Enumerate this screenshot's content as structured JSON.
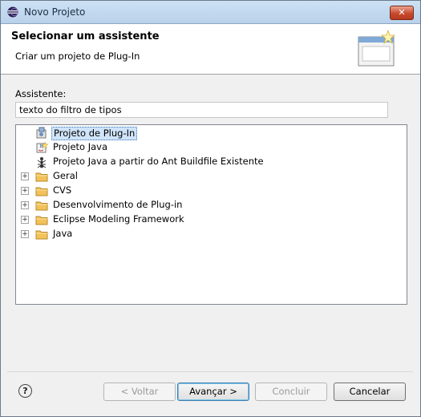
{
  "window": {
    "title": "Novo Projeto",
    "close_label": "✕"
  },
  "banner": {
    "title": "Selecionar um assistente",
    "subtitle": "Criar um projeto de Plug-In"
  },
  "wizard": {
    "label": "Assistente:",
    "filter_value": "texto do filtro de tipos"
  },
  "tree": {
    "items": [
      {
        "label": "Projeto de Plug-In",
        "kind": "leaf",
        "icon": "plugin-project-icon",
        "selected": true
      },
      {
        "label": "Projeto Java",
        "kind": "leaf",
        "icon": "java-project-icon"
      },
      {
        "label": "Projeto Java a partir do Ant Buildfile Existente",
        "kind": "leaf",
        "icon": "ant-icon"
      },
      {
        "label": "Geral",
        "kind": "folder",
        "icon": "folder-icon"
      },
      {
        "label": "CVS",
        "kind": "folder",
        "icon": "folder-icon"
      },
      {
        "label": "Desenvolvimento de Plug-in",
        "kind": "folder",
        "icon": "folder-icon"
      },
      {
        "label": "Eclipse Modeling Framework",
        "kind": "folder",
        "icon": "folder-icon"
      },
      {
        "label": "Java",
        "kind": "folder",
        "icon": "folder-icon"
      }
    ],
    "expander_glyph": "+"
  },
  "footer": {
    "help_glyph": "?",
    "back_label": "< Voltar",
    "next_label": "Avançar >",
    "finish_label": "Concluir",
    "cancel_label": "Cancelar"
  },
  "colors": {
    "selection_bg": "#cfe4fa",
    "folder": "#f2c25a",
    "title_bar": "#c4dbf2"
  }
}
